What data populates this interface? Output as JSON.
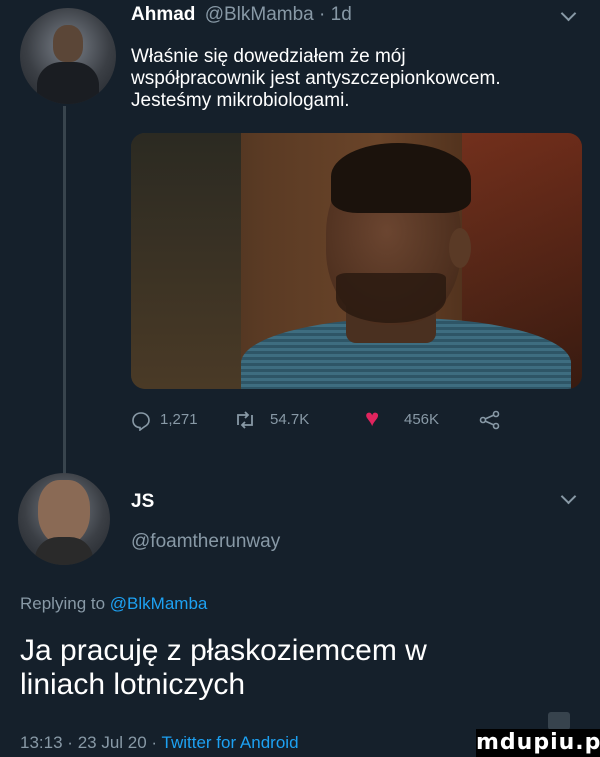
{
  "tweet": {
    "author_name": "Ahmad",
    "author_handle": "@BlkMamba",
    "separator": "·",
    "age": "1d",
    "text_lines": [
      "Właśnie się dowedziałem że mój",
      "współpracownik jest antyszczepionkowcem.",
      "Jesteśmy mikrobiologami."
    ],
    "actions": {
      "reply_count": "1,271",
      "retweet_count": "54.7K",
      "like_count": "456K"
    },
    "icons": [
      "reply-bubble-icon",
      "retweet-icon",
      "heart-icon",
      "share-icon",
      "chevron-down-icon"
    ]
  },
  "reply": {
    "author_name": "JS",
    "author_handle": "@foamtherunway",
    "replying_prefix": "Replying to",
    "replying_handle": "@BlkMamba",
    "text_lines": [
      "Ja pracuję z płaskoziemcem w",
      "liniach lotniczych"
    ],
    "time": "13:13",
    "date": "23 Jul 20",
    "client": "Twitter for Android",
    "separator": "·"
  },
  "watermark": "mdupiu.pl",
  "colors": {
    "background": "#15202b",
    "muted": "#8899a6",
    "link": "#1da1f2",
    "like": "#e0245e"
  }
}
